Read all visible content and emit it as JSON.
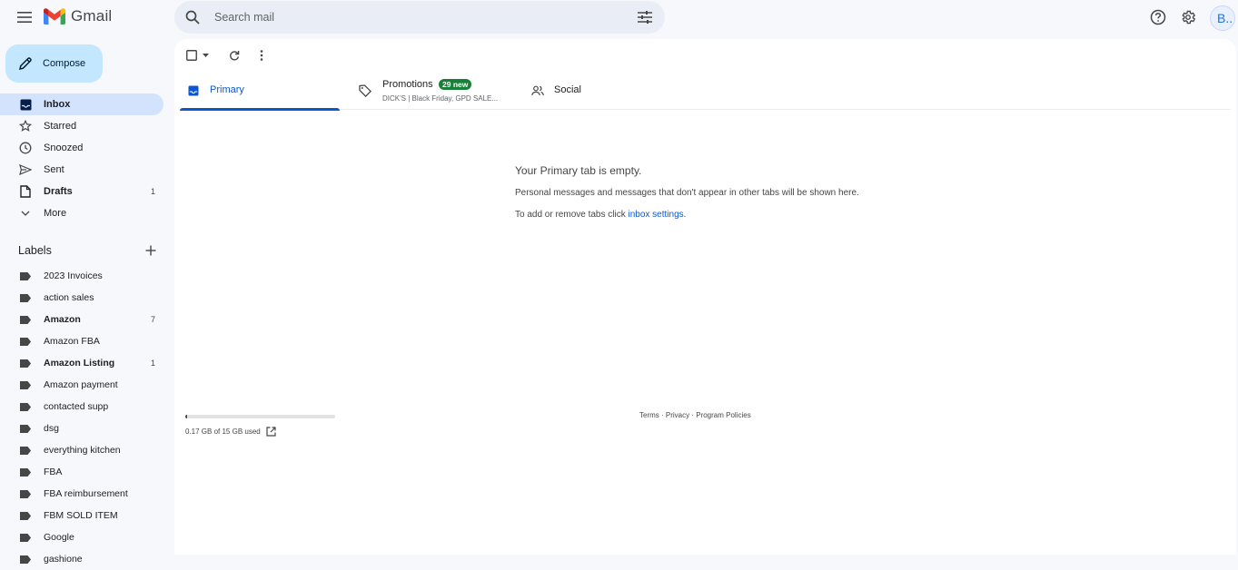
{
  "app": {
    "name": "Gmail"
  },
  "search": {
    "placeholder": "Search mail"
  },
  "header": {
    "avatar_initial": "B.."
  },
  "compose": {
    "label": "Compose"
  },
  "nav": {
    "items": [
      {
        "label": "Inbox",
        "count": ""
      },
      {
        "label": "Starred",
        "count": ""
      },
      {
        "label": "Snoozed",
        "count": ""
      },
      {
        "label": "Sent",
        "count": ""
      },
      {
        "label": "Drafts",
        "count": "1"
      },
      {
        "label": "More",
        "count": ""
      }
    ]
  },
  "labels": {
    "title": "Labels",
    "items": [
      {
        "label": "2023 Invoices",
        "count": ""
      },
      {
        "label": "action sales",
        "count": ""
      },
      {
        "label": "Amazon",
        "count": "7"
      },
      {
        "label": "Amazon FBA",
        "count": ""
      },
      {
        "label": "Amazon Listing",
        "count": "1"
      },
      {
        "label": "Amazon payment",
        "count": ""
      },
      {
        "label": "contacted supp",
        "count": ""
      },
      {
        "label": "dsg",
        "count": ""
      },
      {
        "label": "everything kitchen",
        "count": ""
      },
      {
        "label": "FBA",
        "count": ""
      },
      {
        "label": "FBA reimbursement",
        "count": ""
      },
      {
        "label": "FBM SOLD ITEM",
        "count": ""
      },
      {
        "label": "Google",
        "count": ""
      },
      {
        "label": "gashione",
        "count": ""
      }
    ]
  },
  "tabs": {
    "primary": {
      "label": "Primary"
    },
    "promotions": {
      "label": "Promotions",
      "badge": "29 new",
      "snippet": "DICK'S | Black Friday, GPD SALE..."
    },
    "social": {
      "label": "Social"
    }
  },
  "empty_state": {
    "title": "Your Primary tab is empty.",
    "subtitle": "Personal messages and messages that don't appear in other tabs will be shown here.",
    "link_prefix": "To add or remove tabs click ",
    "link_text": "inbox settings",
    "link_suffix": "."
  },
  "storage": {
    "text": "0.17 GB of 15 GB used",
    "used_fraction": 0.011
  },
  "footer": {
    "terms": "Terms",
    "sep1": " · ",
    "privacy": "Privacy",
    "sep2": " · ",
    "policies": "Program Policies"
  },
  "colors": {
    "accent": "#0b57d0",
    "compose_bg": "#c2e7ff",
    "active_nav": "#d3e3fd",
    "badge": "#188038"
  }
}
